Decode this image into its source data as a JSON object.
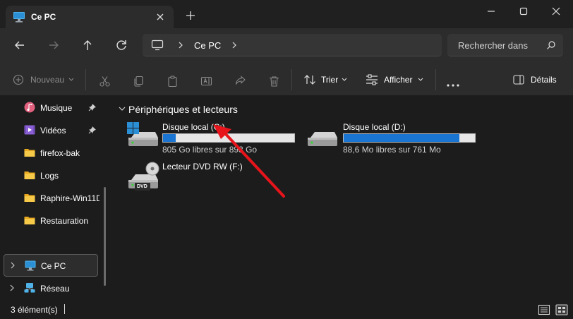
{
  "window": {
    "tab_title": "Ce PC",
    "minimize_icon": "minimize-icon",
    "maximize_icon": "maximize-icon",
    "close_icon": "close-icon"
  },
  "address": {
    "crumb": "Ce PC",
    "search_placeholder": "Rechercher dans"
  },
  "commandbar": {
    "new_label": "Nouveau",
    "sort_label": "Trier",
    "view_label": "Afficher",
    "details_label": "Détails"
  },
  "sidebar": {
    "items": [
      {
        "label": "Musique",
        "icon": "music-icon",
        "pinned": true
      },
      {
        "label": "Vidéos",
        "icon": "videos-icon",
        "pinned": true
      },
      {
        "label": "firefox-bak",
        "icon": "folder-icon",
        "pinned": false
      },
      {
        "label": "Logs",
        "icon": "folder-icon",
        "pinned": false
      },
      {
        "label": "Raphire-Win11D",
        "icon": "folder-icon",
        "pinned": false
      },
      {
        "label": "Restauration",
        "icon": "folder-icon",
        "pinned": false
      }
    ],
    "this_pc": "Ce PC",
    "network": "Réseau"
  },
  "main": {
    "group_title": "Périphériques et lecteurs",
    "drives": [
      {
        "name": "Disque local (C:)",
        "free": "805 Go libres sur 893 Go",
        "used_fraction": 0.099
      },
      {
        "name": "Disque local (D:)",
        "free": "88,6 Mo libres sur 761 Mo",
        "used_fraction": 0.884
      },
      {
        "name": "Lecteur DVD RW (F:)",
        "dvd_label": "DVD"
      }
    ]
  },
  "status": {
    "count": "3 élément(s)"
  },
  "colors": {
    "accent": "#1a74d1",
    "annotation_arrow": "#e8141b"
  }
}
